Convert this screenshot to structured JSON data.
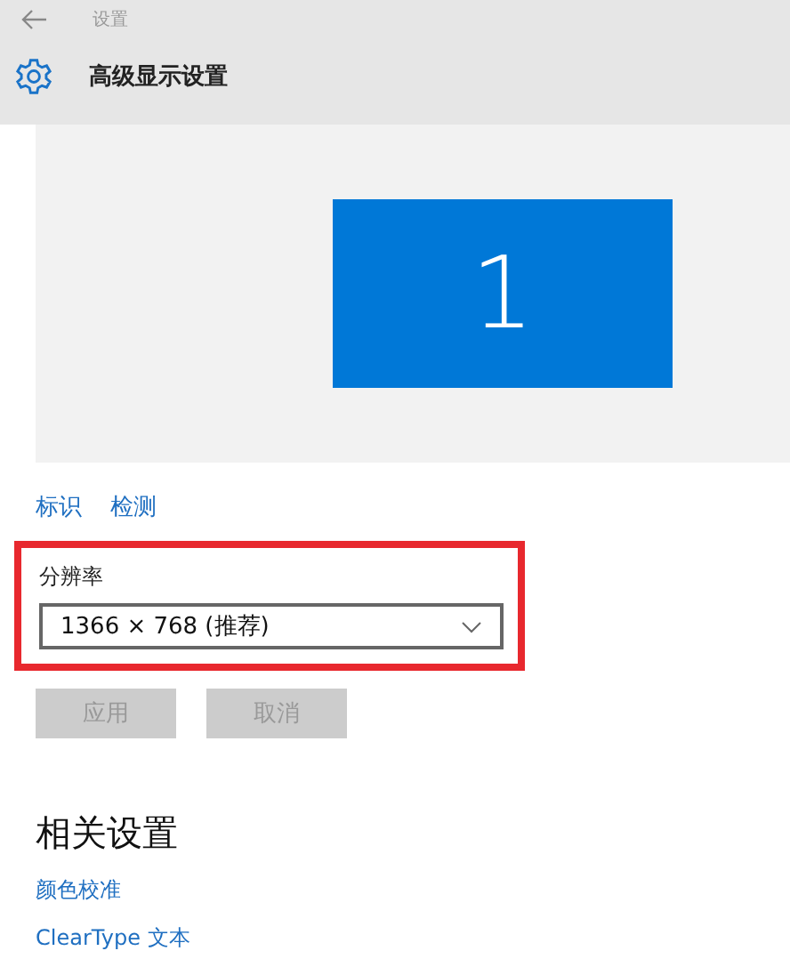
{
  "window": {
    "title": "设置"
  },
  "page": {
    "title": "高级显示设置"
  },
  "display_preview": {
    "monitors": [
      {
        "label": "1",
        "selected": true
      }
    ]
  },
  "display_links": [
    "标识",
    "检测"
  ],
  "resolution": {
    "label": "分辨率",
    "value": "1366 × 768 (推荐)",
    "highlighted": true
  },
  "buttons": [
    {
      "label": "应用",
      "disabled": true
    },
    {
      "label": "取消",
      "disabled": true
    }
  ],
  "related_settings": {
    "title": "相关设置",
    "links": [
      "颜色校准",
      "ClearType 文本"
    ]
  }
}
